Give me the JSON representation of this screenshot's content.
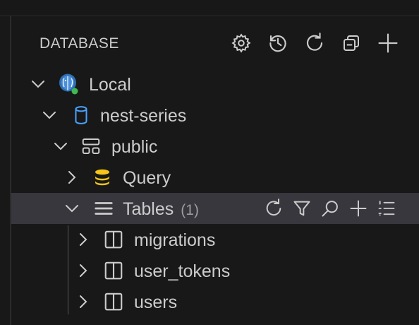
{
  "header": {
    "title": "DATABASE"
  },
  "tree": {
    "connection": {
      "label": "Local"
    },
    "database": {
      "label": "nest-series"
    },
    "schema": {
      "label": "public"
    },
    "query": {
      "label": "Query"
    },
    "tables": {
      "label": "Tables",
      "count": "(1)"
    },
    "table_items": [
      {
        "label": "migrations"
      },
      {
        "label": "user_tokens"
      },
      {
        "label": "users"
      }
    ]
  },
  "colors": {
    "background": "#181818",
    "selected_row": "#37373d",
    "db_icon_blue": "#4aa3ff",
    "query_icon_yellow": "#f5c518",
    "status_green": "#3fb950"
  }
}
